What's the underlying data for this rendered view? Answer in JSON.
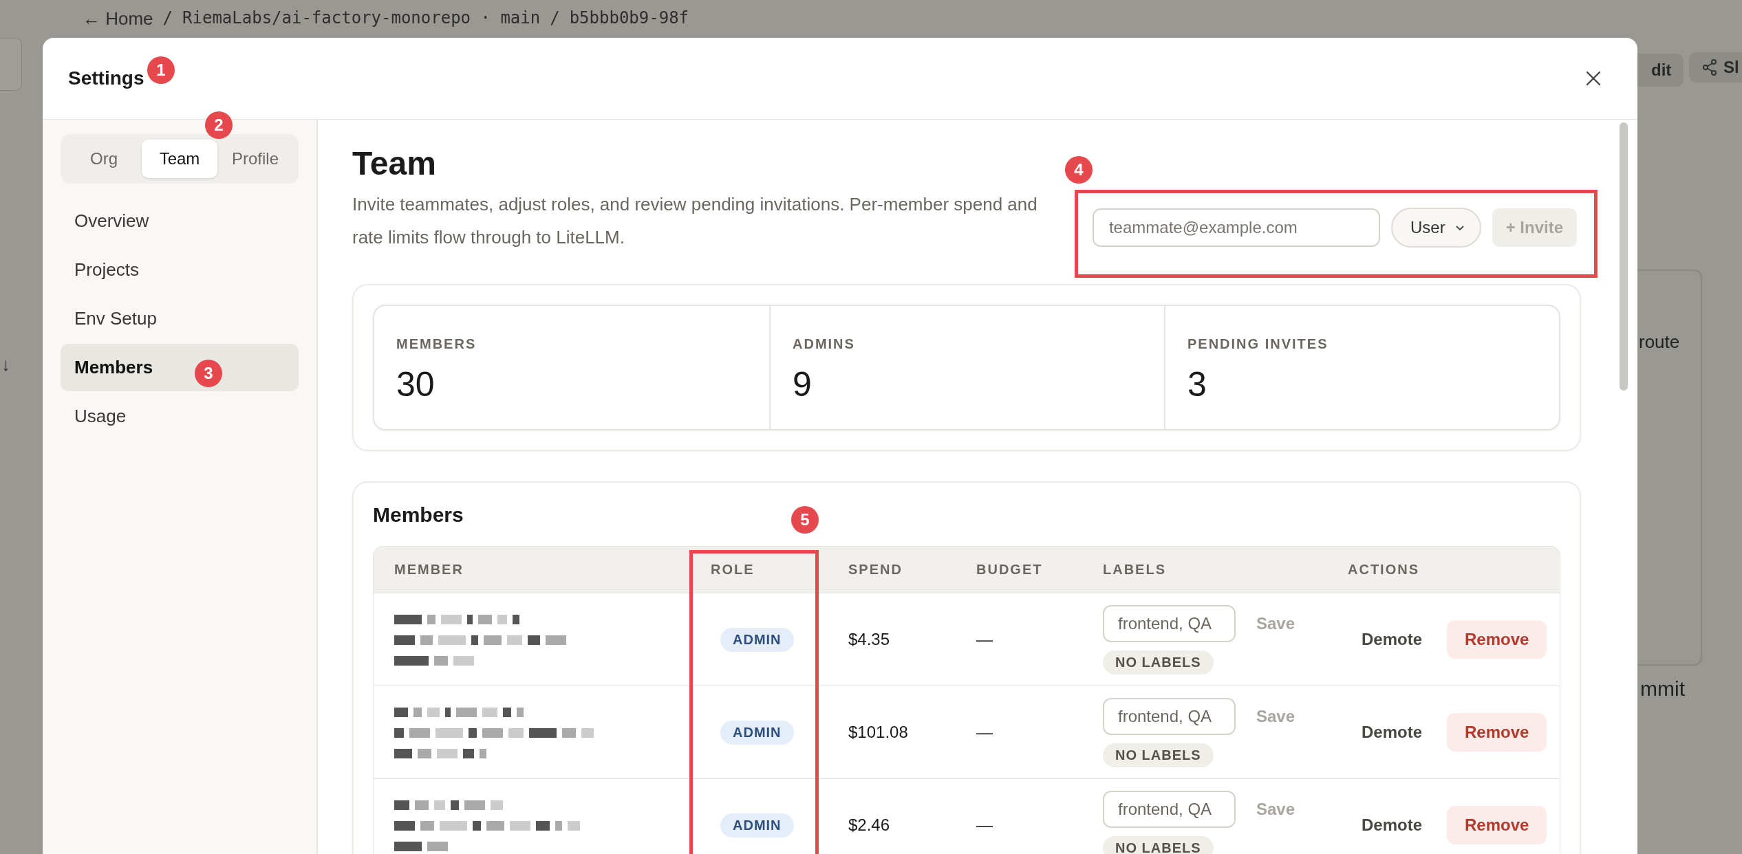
{
  "background": {
    "breadcrumb": [
      {
        "text": "← Home",
        "kind": "link"
      },
      {
        "text": "/",
        "kind": "sep"
      },
      {
        "text": "RiemaLabs/ai-factory-monorepo · main",
        "kind": "link"
      },
      {
        "text": "/",
        "kind": "sep"
      },
      {
        "text": "b5bbb0b9-98f",
        "kind": "current"
      }
    ],
    "edit_button": "dit",
    "share_button": "Sl",
    "table_text": "route",
    "footer_text": "mmit",
    "side_arrow": "↓"
  },
  "modal": {
    "title": "Settings"
  },
  "sidebar": {
    "tabs": [
      {
        "label": "Org",
        "selected": false
      },
      {
        "label": "Team",
        "selected": true
      },
      {
        "label": "Profile",
        "selected": false
      }
    ],
    "items": [
      {
        "label": "Overview",
        "selected": false
      },
      {
        "label": "Projects",
        "selected": false
      },
      {
        "label": "Env Setup",
        "selected": false
      },
      {
        "label": "Members",
        "selected": true
      },
      {
        "label": "Usage",
        "selected": false
      }
    ]
  },
  "header": {
    "title": "Team",
    "description": "Invite teammates, adjust roles, and review pending invitations. Per-member spend and rate limits flow through to LiteLLM.",
    "invite": {
      "placeholder": "teammate@example.com",
      "role": "User",
      "button": "+ Invite",
      "disabled": true
    }
  },
  "stats": [
    {
      "label": "MEMBERS",
      "value": "30"
    },
    {
      "label": "ADMINS",
      "value": "9"
    },
    {
      "label": "PENDING INVITES",
      "value": "3"
    }
  ],
  "members": {
    "title": "Members",
    "columns": [
      "MEMBER",
      "ROLE",
      "SPEND",
      "BUDGET",
      "LABELS",
      "ACTIONS"
    ],
    "rows": [
      {
        "role": "ADMIN",
        "spend": "$4.35",
        "budget": "—",
        "labels_placeholder": "frontend, QA",
        "save": "Save",
        "labels_badge": "NO LABELS",
        "demote": "Demote",
        "remove": "Remove"
      },
      {
        "role": "ADMIN",
        "spend": "$101.08",
        "budget": "—",
        "labels_placeholder": "frontend, QA",
        "save": "Save",
        "labels_badge": "NO LABELS",
        "demote": "Demote",
        "remove": "Remove"
      },
      {
        "role": "ADMIN",
        "spend": "$2.46",
        "budget": "—",
        "labels_placeholder": "frontend, QA",
        "save": "Save",
        "labels_badge": "NO LABELS",
        "demote": "Demote",
        "remove": "Remove"
      }
    ]
  },
  "annotations": [
    {
      "number": "1"
    },
    {
      "number": "2"
    },
    {
      "number": "3"
    },
    {
      "number": "4"
    },
    {
      "number": "5"
    }
  ]
}
